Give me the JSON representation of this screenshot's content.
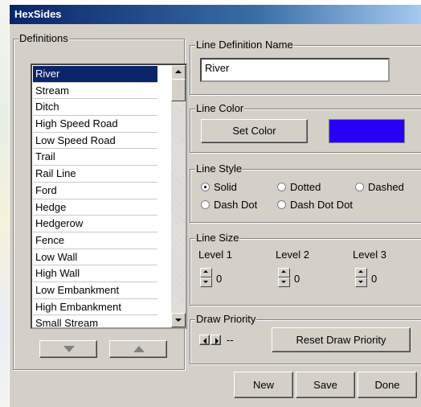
{
  "window": {
    "title": "HexSides"
  },
  "definitions": {
    "legend": "Definitions",
    "items": [
      "River",
      "Stream",
      "Ditch",
      "High Speed Road",
      "Low Speed Road",
      "Trail",
      "Rail Line",
      "Ford",
      "Hedge",
      "Hedgerow",
      "Fence",
      "Low Wall",
      "High Wall",
      "Low Embankment",
      "High Embankment",
      "Small Stream"
    ],
    "selected": "River"
  },
  "line_definition_name": {
    "legend": "Line Definition Name",
    "value": "River"
  },
  "line_color": {
    "legend": "Line Color",
    "button": "Set Color",
    "swatch_color": "#2800f8"
  },
  "line_style": {
    "legend": "Line Style",
    "options": [
      "Solid",
      "Dotted",
      "Dashed",
      "Dash Dot",
      "Dash Dot Dot"
    ],
    "selected": "Solid"
  },
  "line_size": {
    "legend": "Line Size",
    "levels": [
      {
        "label": "Level 1",
        "value": "0"
      },
      {
        "label": "Level 2",
        "value": "0"
      },
      {
        "label": "Level 3",
        "value": "0"
      }
    ]
  },
  "draw_priority": {
    "legend": "Draw Priority",
    "value": "--",
    "reset_button": "Reset Draw Priority"
  },
  "footer": {
    "new": "New",
    "save": "Save",
    "done": "Done"
  }
}
